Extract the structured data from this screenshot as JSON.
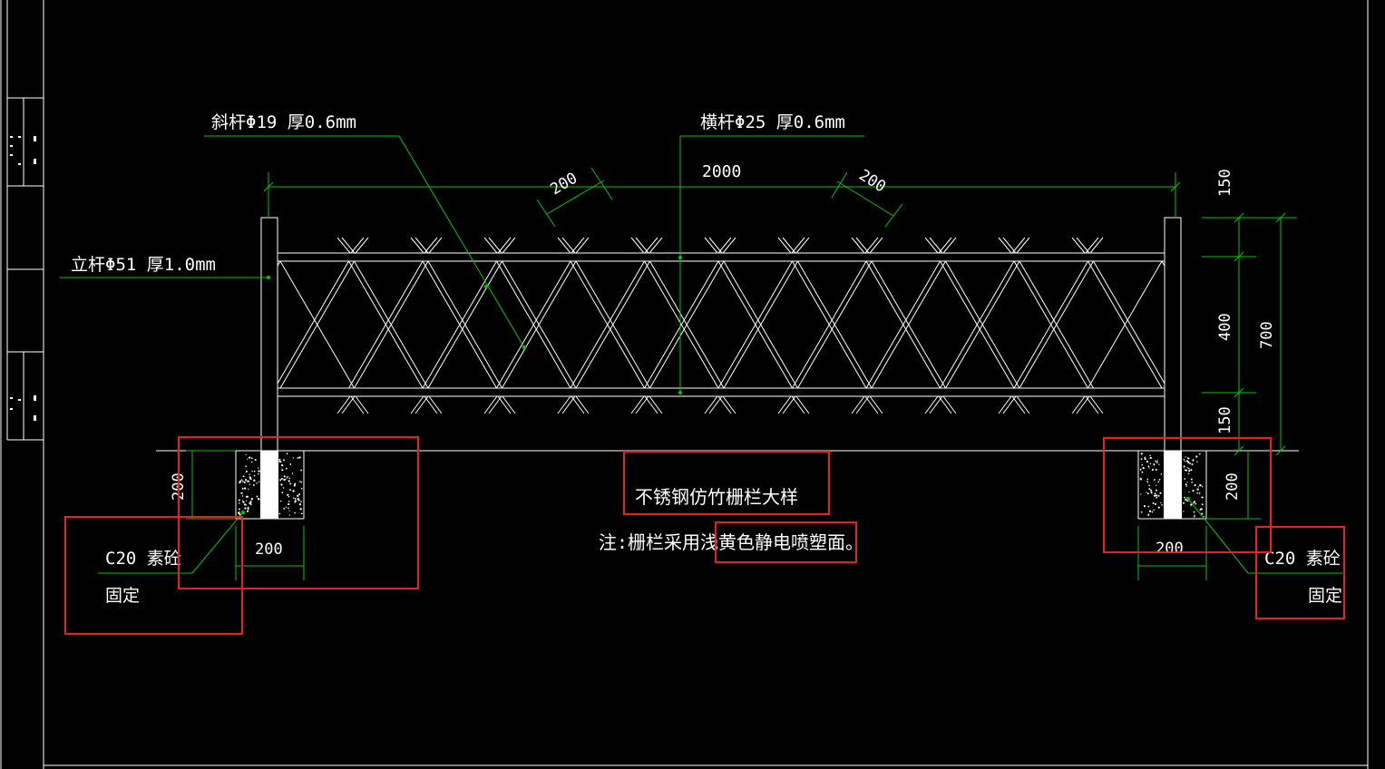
{
  "drawing": {
    "title": "不锈钢仿竹栅栏大样",
    "note": "注:栅栏采用浅黄色静电喷塑面。",
    "labels": {
      "diagonal_rod": "斜杆Φ19  厚0.6mm",
      "horizontal_rod": "横杆Φ25  厚0.6mm",
      "post": "立杆Φ51  厚1.0mm",
      "footing_left_line1": "C20  素砼",
      "footing_left_line2": "固定",
      "footing_right_line1": "C20  素砼",
      "footing_right_line2": "固定"
    },
    "dimensions": {
      "total_length": "2000",
      "diag_spacing_left": "200",
      "diag_spacing_right": "200",
      "top_margin": "150",
      "middle": "400",
      "bottom_margin": "150",
      "total_height": "700",
      "footing_depth_left": "200",
      "footing_width_left": "200",
      "footing_depth_right": "200",
      "footing_width_right": "200"
    },
    "colors": {
      "background": "#000000",
      "line": "#ffffff",
      "dimension": "#00c800",
      "annotation_box": "#e8211a"
    }
  }
}
